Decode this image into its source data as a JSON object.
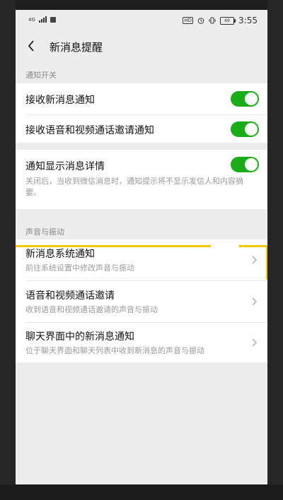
{
  "status_bar": {
    "network": "4G",
    "battery": "69",
    "time": "3:55"
  },
  "header": {
    "title": "新消息提醒"
  },
  "sections": {
    "notify_switch": {
      "label": "通知开关",
      "receive_new": {
        "label": "接收新消息通知",
        "on": true
      },
      "receive_calls": {
        "label": "接收语音和视频通话邀请通知",
        "on": true
      },
      "show_details": {
        "label": "通知显示消息详情",
        "on": true,
        "desc": "关闭后，当收到微信消息时，通知提示将不显示发信人和内容摘要。"
      }
    },
    "sound_vibration": {
      "label": "声音与振动",
      "items": [
        {
          "title": "新消息系统通知",
          "desc": "前往系统设置中修改声音与振动"
        },
        {
          "title": "语音和视频通话邀请",
          "desc": "收到语音和视频通话邀请的声音与振动"
        },
        {
          "title": "聊天界面中的新消息通知",
          "desc": "位于聊天界面和聊天列表中收到新消息的声音与振动"
        }
      ]
    }
  },
  "colors": {
    "toggle_on": "#1aad19",
    "highlight": "#f5c800",
    "background": "#ededed"
  }
}
